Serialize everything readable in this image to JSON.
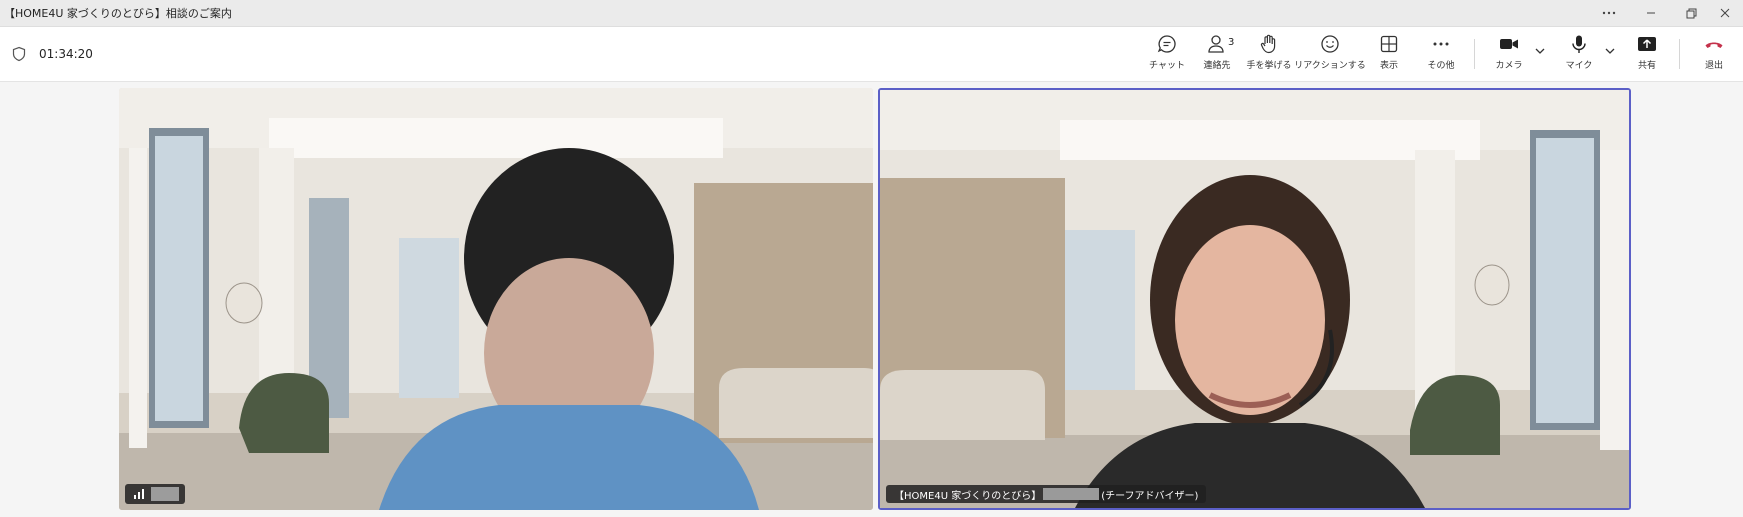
{
  "window": {
    "title": "【HOME4U 家づくりのとびら】相談のご案内",
    "more_icon": "more-icon",
    "minimize_icon": "minimize-icon",
    "restore_icon": "restore-icon",
    "close_icon": "close-icon"
  },
  "meeting": {
    "timer": "01:34:20",
    "participant_count": "3"
  },
  "toolbar": {
    "chat": "チャット",
    "people": "連絡先",
    "raise_hand": "手を挙げる",
    "react": "リアクションする",
    "view": "表示",
    "more": "その他",
    "camera": "カメラ",
    "mic": "マイク",
    "share": "共有",
    "leave": "退出"
  },
  "participants": {
    "right_name_prefix": "【HOME4U 家づくりのとびら】",
    "right_name_suffix": "(チーフアドバイザー)"
  },
  "colors": {
    "accent": "#5b5fc7",
    "leave_red": "#c4314b"
  }
}
